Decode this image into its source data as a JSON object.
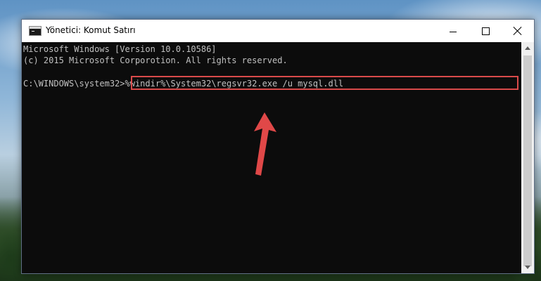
{
  "window": {
    "title": "Yönetici: Komut Satırı",
    "icon": "cmd-icon"
  },
  "titlebar_buttons": [
    "minimize-icon",
    "maximize-icon",
    "close-icon"
  ],
  "console": {
    "lines": [
      "Microsoft Windows [Version 10.0.10586]",
      "(c) 2015 Microsoft Corporotion. All rights reserved.",
      "",
      "C:\\WINDOWS\\system32>%windir%\\System32\\regsvr32.exe /u mysql.dll"
    ],
    "prompt": "C:\\WINDOWS\\system32>",
    "command": "%windir%\\System32\\regsvr32.exe /u mysql.dll"
  },
  "colors": {
    "console_bg": "#0c0c0c",
    "console_text": "#c0c0c0",
    "highlight": "#d94a4a"
  }
}
